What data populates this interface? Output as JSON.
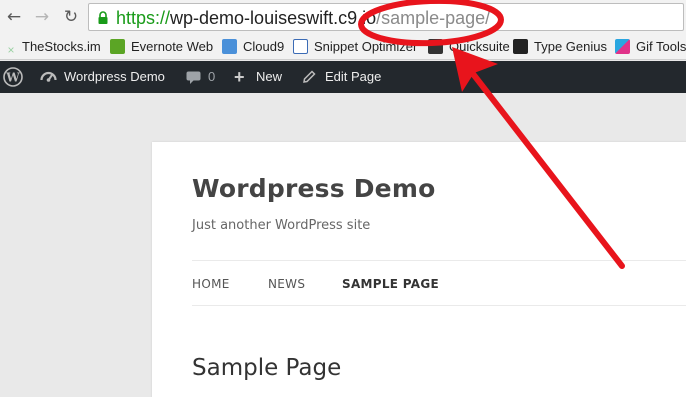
{
  "browser": {
    "url": {
      "scheme": "https://",
      "host": "wp-demo-louiseswift.c9.io",
      "path": "/sample-page/"
    },
    "bookmarks": [
      {
        "label": "TheStocks.im",
        "icon": "thestocks-icon",
        "color": "#9ad1a3"
      },
      {
        "label": "Evernote Web",
        "icon": "evernote-icon",
        "color": "#5ba525"
      },
      {
        "label": "Cloud9",
        "icon": "cloud9-icon",
        "color": "#4a90d9"
      },
      {
        "label": "Snippet Optimizer",
        "icon": "seo-icon",
        "color": "#3b6bb5"
      },
      {
        "label": "Quicksuite",
        "icon": "quicksuite-icon",
        "color": "#333333"
      },
      {
        "label": "Type Genius",
        "icon": "typegenius-icon",
        "color": "#222222"
      },
      {
        "label": "Gif Tools",
        "icon": "giftools-icon",
        "color": "#e0338a"
      }
    ]
  },
  "adminbar": {
    "site_name": "Wordpress Demo",
    "comments_count": "0",
    "new_label": "New",
    "edit_label": "Edit Page"
  },
  "site": {
    "title": "Wordpress Demo",
    "tagline": "Just another WordPress site",
    "menu": [
      "HOME",
      "NEWS",
      "SAMPLE PAGE"
    ],
    "active_menu_index": 2
  },
  "page": {
    "title": "Sample Page"
  },
  "colors": {
    "annotation": "#e8141c",
    "adminbar_bg": "#23282d",
    "secure_green": "#199b19"
  }
}
